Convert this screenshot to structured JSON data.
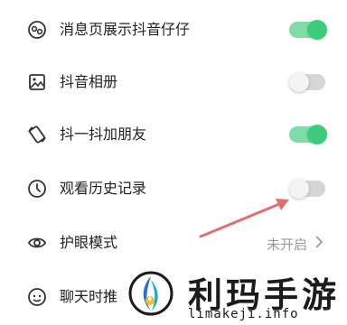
{
  "settings": {
    "items": [
      {
        "label": "消息页展示抖音仔仔",
        "icon": "people-circle-icon",
        "toggle": "on"
      },
      {
        "label": "抖音相册",
        "icon": "photo-album-icon",
        "toggle": "off"
      },
      {
        "label": "抖一抖加朋友",
        "icon": "shake-icon",
        "toggle": "on"
      },
      {
        "label": "观看历史记录",
        "icon": "clock-icon",
        "toggle": "off"
      },
      {
        "label": "护眼模式",
        "icon": "eye-icon",
        "value": "未开启"
      },
      {
        "label": "聊天时推",
        "icon": "chat-smile-icon"
      }
    ]
  },
  "watermark": {
    "brand": "利玛手游",
    "domain": "limakeji.info"
  },
  "colors": {
    "toggle_on_track": "#7fdca6",
    "toggle_on_knob": "#3ccc7c",
    "toggle_off_track": "#d6d6d6",
    "annotation_arrow": "#e07070"
  }
}
